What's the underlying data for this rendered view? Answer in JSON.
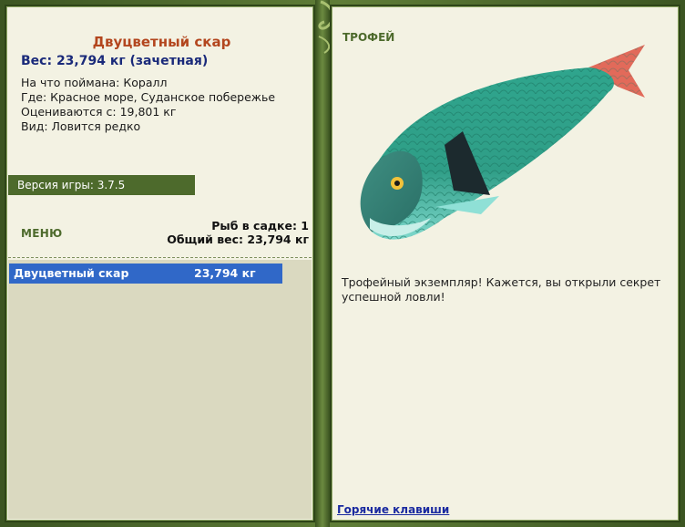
{
  "fish": {
    "name": "Двуцветный скар",
    "weight_line": "Вес: 23,794 кг (зачетная)",
    "bait_line": "На что поймана: Коралл",
    "location_line": "Где: Красное море, Суданское побережье",
    "rated_line": "Оцениваются с: 19,801 кг",
    "kind_line": "Вид: Ловится редко"
  },
  "version": "Версия игры: 3.7.5",
  "menu_label": "МЕНЮ",
  "summary": {
    "count_line": "Рыб в садке: 1",
    "total_line": "Общий вес: 23,794 кг"
  },
  "catch_list": [
    {
      "name": "Двуцветный скар",
      "weight": "23,794 кг"
    }
  ],
  "trophy": {
    "label": "ТРОФЕЙ",
    "description": "Трофейный экземпляр! Кажется, вы открыли секрет успешной ловли!"
  },
  "hotkeys_label": "Горячие клавиши",
  "colors": {
    "frame": "#4d6a2c",
    "panel": "#f3f2e3",
    "title": "#b3461e",
    "weight": "#1a2a7a",
    "selection": "#3068c8"
  }
}
